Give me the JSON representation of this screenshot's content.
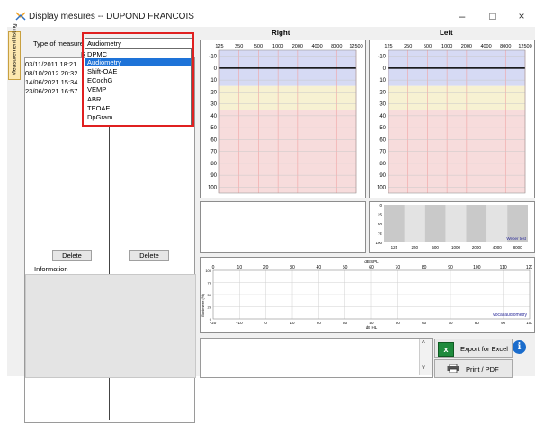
{
  "window": {
    "title": "Display mesures -- DUPOND FRANCOIS",
    "minimize": "–",
    "maximize": "□",
    "close": "×"
  },
  "side_tab": {
    "label": "Measurement listing"
  },
  "left_panel": {
    "type_label": "Type of measure",
    "combo_value": "Audiometry",
    "dropdown_options": [
      "DPMC",
      "Audiometry",
      "Shift-OAE",
      "ECochG",
      "VEMP",
      "ABR",
      "TEOAE",
      "DpGram"
    ],
    "selected_index": 1,
    "right_header": "Right",
    "dates": [
      "03/11/2011 18:21",
      "08/10/2012 20:32",
      "14/06/2021 15:34",
      "23/06/2021 16:57"
    ],
    "delete_left": "Delete",
    "delete_right": "Delete",
    "information_label": "Information"
  },
  "audiograms": {
    "right_title": "Right",
    "left_title": "Left",
    "freq_labels": [
      "125",
      "250",
      "500",
      "1000",
      "2000",
      "4000",
      "8000",
      "12500"
    ],
    "db_labels": [
      "-10",
      "0",
      "10",
      "20",
      "30",
      "40",
      "50",
      "60",
      "70",
      "80",
      "90",
      "100"
    ]
  },
  "weber": {
    "y_labels": [
      "0",
      "25",
      "50",
      "75",
      "100"
    ],
    "freq_labels": [
      "125",
      "250",
      "500",
      "1000",
      "2000",
      "4000",
      "8000"
    ],
    "caption": "Weber test"
  },
  "vocal": {
    "top_axis_title": "dB SPL",
    "top_axis": [
      "0",
      "10",
      "20",
      "30",
      "40",
      "50",
      "60",
      "70",
      "80",
      "90",
      "100",
      "110",
      "120"
    ],
    "bottom_axis_title": "dB HL",
    "bottom_axis": [
      "-20",
      "-10",
      "0",
      "10",
      "20",
      "30",
      "40",
      "50",
      "60",
      "70",
      "80",
      "90",
      "100"
    ],
    "y_title": "Banimetre (%)",
    "y_labels": [
      "100",
      "75",
      "50",
      "25",
      "0"
    ],
    "caption": "Vocal audiometry"
  },
  "actions": {
    "export_label": "Export for Excel",
    "print_label": "Print / PDF",
    "excel_glyph": "x",
    "info_glyph": "i",
    "scroll_up": "^",
    "scroll_down": "v"
  }
}
